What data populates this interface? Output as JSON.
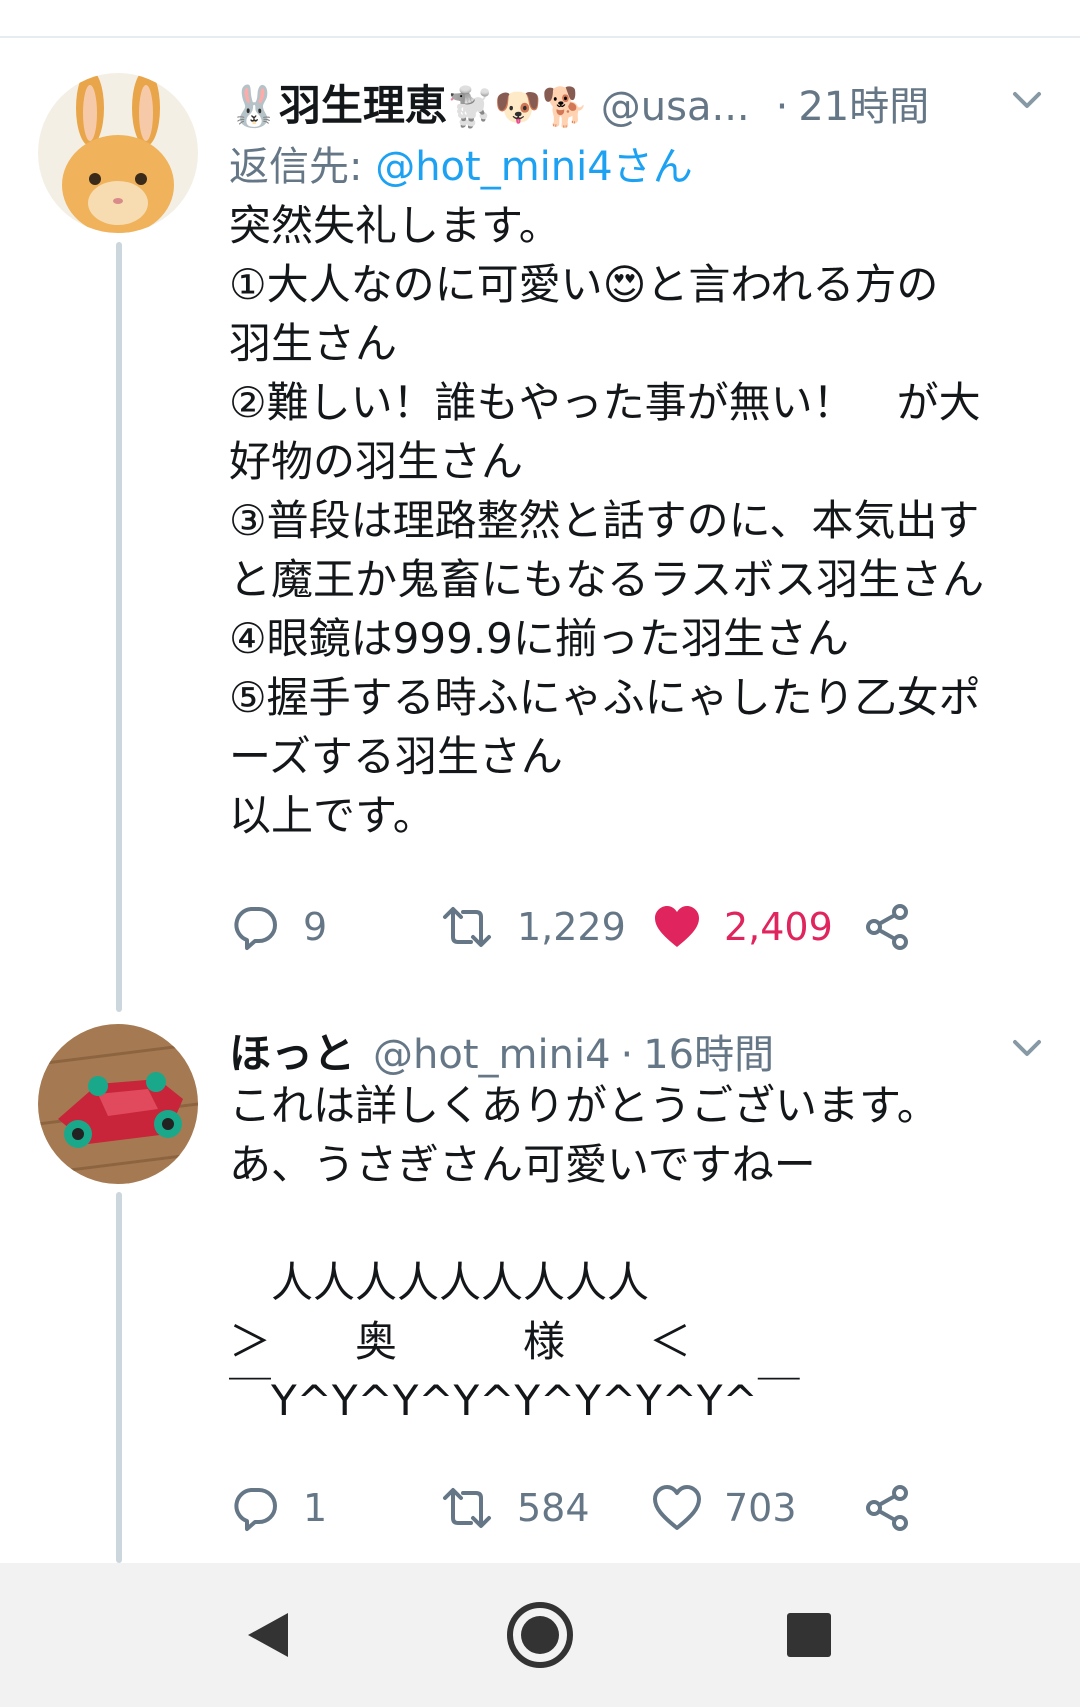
{
  "tweets": [
    {
      "name": "羽生理恵",
      "name_emojis_before": "🐰",
      "name_emojis_after": "🐩🐶🐕",
      "handle": "@usa...",
      "separator": "·",
      "time": "21時間",
      "reply_prefix": "返信先:",
      "reply_mention": "@hot_mini4さん",
      "text": "突然失礼します。\n①大人なのに可愛い😍と言われる方の\n羽生さん\n②難しい！誰もやった事が無い！　が大\n好物の羽生さん\n③普段は理路整然と話すのに、本気出す\nと魔王か鬼畜にもなるラスボス羽生さん\n④眼鏡は999.9に揃った羽生さん\n⑤握手する時ふにゃふにゃしたり乙女ポ\nーズする羽生さん\n以上です。",
      "reply_count": "9",
      "retweet_count": "1,229",
      "like_count": "2,409",
      "liked": true
    },
    {
      "name": "ほっと",
      "handle": "@hot_mini4",
      "separator": "·",
      "time": "16時間",
      "text": "これは詳しくありがとうございます。\nあ、うさぎさん可愛いですねー\n\n　人人人人人人人人人\n＞　　奥　　　様　　＜\n￣Y^Y^Y^Y^Y^Y^Y^Y^￣",
      "reply_count": "1",
      "retweet_count": "584",
      "like_count": "703",
      "liked": false
    }
  ],
  "colors": {
    "accent": "#1da1f2",
    "like": "#e0245e",
    "muted": "#657786",
    "thread": "#ccd6dd"
  },
  "icons": [
    "reply-icon",
    "retweet-icon",
    "heart-icon",
    "share-icon",
    "chevron-down-icon",
    "back-icon",
    "home-icon",
    "recents-icon"
  ]
}
